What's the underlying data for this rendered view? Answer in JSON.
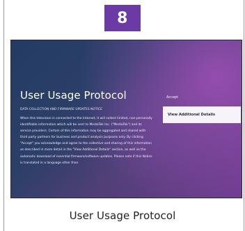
{
  "step_badge": {
    "number": "8"
  },
  "screen": {
    "title": "User Usage Protocol",
    "notice_heading": "DATA COLLECTION AND FIRMWARE UPDATES NOTICE",
    "notice_body": "When this television is connected to the Internet, it will collect limited, non-personally identifiable information which will be sent to MediaTek Inc. (\"MediaTek\") and its service providers. Certain of this information may be aggregated and shared with third party partners for business and product analysis purposes only. By clicking \"Accept\" you acknowledge and agree to the collective and sharing of this information as described in more detail in the \"View Additional Details\" section, as well as the automatic download of essential firmware/software updates. Please note if this Notice is translated in a language other than",
    "accept_label": "Accept",
    "details_label": "View Additional Details"
  },
  "caption": {
    "text": "User Usage Protocol"
  },
  "colors": {
    "badge": "#6c3aa4",
    "background_start": "#233c63",
    "background_end": "#6d3b8e",
    "highlight_button": "#f6f4f8",
    "caption_text": "#222222"
  }
}
